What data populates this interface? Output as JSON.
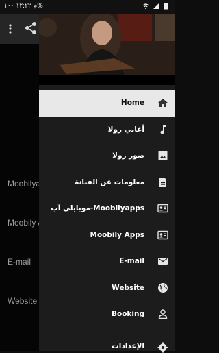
{
  "status_bar": {
    "left_text": "م ١٢:٢٢ ١٠٠%",
    "icons": [
      "wifi-icon",
      "signal-icon",
      "battery-icon"
    ]
  },
  "background_app": {
    "items": [
      "Moobilya",
      "Moobily A",
      "E-mail",
      "Website"
    ]
  },
  "drawer": {
    "menu_items": [
      {
        "label": "Home",
        "icon": "home-icon",
        "active": true
      },
      {
        "label": "أغاني رولا",
        "icon": "music-icon",
        "active": false
      },
      {
        "label": "صور رولا",
        "icon": "image-icon",
        "active": false
      },
      {
        "label": "معلومات عن الفنانة",
        "icon": "document-icon",
        "active": false
      },
      {
        "label": "موبايلي آب-Moobilyapps",
        "icon": "contact-card-icon",
        "active": false
      },
      {
        "label": "Moobily Apps",
        "icon": "contact-card-icon",
        "active": false
      },
      {
        "label": "E-mail",
        "icon": "mail-icon",
        "active": false
      },
      {
        "label": "Website",
        "icon": "globe-icon",
        "active": false
      },
      {
        "label": "Booking",
        "icon": "person-icon",
        "active": false
      }
    ],
    "settings_label": "الإعدادات"
  }
}
